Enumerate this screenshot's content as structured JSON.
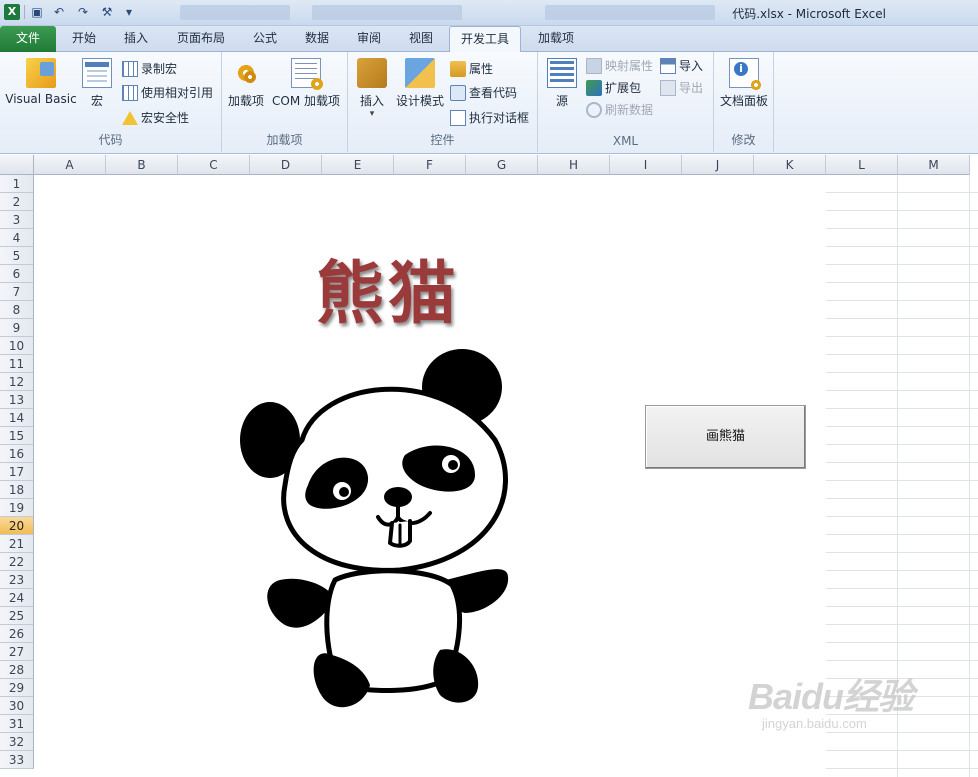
{
  "window": {
    "title": "代码.xlsx - Microsoft Excel",
    "app_icon": "X"
  },
  "tabs": [
    "文件",
    "开始",
    "插入",
    "页面布局",
    "公式",
    "数据",
    "审阅",
    "视图",
    "开发工具",
    "加载项"
  ],
  "ribbon": {
    "code_group": {
      "label": "代码",
      "visual_basic": "Visual Basic",
      "macros": "宏",
      "record_macro": "录制宏",
      "relative_refs": "使用相对引用",
      "macro_security": "宏安全性"
    },
    "addins_group": {
      "label": "加载项",
      "addins": "加载项",
      "com_addins": "COM 加载项"
    },
    "controls_group": {
      "label": "控件",
      "insert": "插入",
      "design_mode": "设计模式",
      "properties": "属性",
      "view_code": "查看代码",
      "run_dialog": "执行对话框"
    },
    "xml_group": {
      "label": "XML",
      "source": "源",
      "map_properties": "映射属性",
      "expansion_packs": "扩展包",
      "refresh_data": "刷新数据",
      "import": "导入",
      "export": "导出"
    },
    "modify_group": {
      "label": "修改",
      "document_panel": "文档面板"
    }
  },
  "sheet": {
    "columns": [
      "A",
      "B",
      "C",
      "D",
      "E",
      "F",
      "G",
      "H",
      "I",
      "J",
      "K",
      "L",
      "M"
    ],
    "rows": [
      "1",
      "2",
      "3",
      "4",
      "5",
      "6",
      "7",
      "8",
      "9",
      "10",
      "11",
      "12",
      "13",
      "14",
      "15",
      "16",
      "17",
      "18",
      "19",
      "20",
      "21",
      "22",
      "23",
      "24",
      "25",
      "26",
      "27",
      "28",
      "29",
      "30",
      "31",
      "32",
      "33"
    ],
    "selected_row": "20",
    "wordart": "熊猫",
    "button_label": "画熊猫"
  },
  "watermark": {
    "main": "Baidu经验",
    "sub": "jingyan.baidu.com"
  },
  "colors": {
    "file_tab": "#1f7a36",
    "wordart": "#9b3a3a",
    "selected_row": "#f1bd55"
  }
}
